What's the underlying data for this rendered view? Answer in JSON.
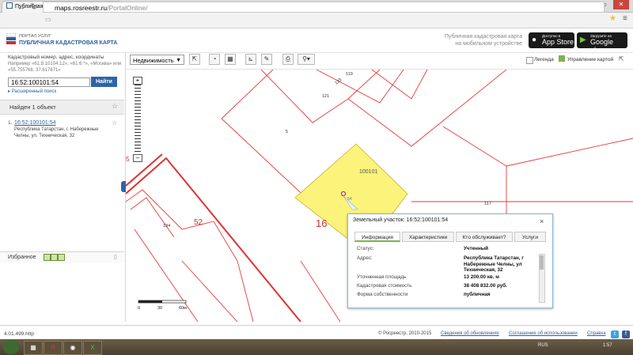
{
  "browser": {
    "tab_title": "Публичная кадастрова",
    "url_host": "maps.rosreestr.ru",
    "url_path": "/PortalOnline/"
  },
  "header": {
    "portal": "ПОРТАЛ УСЛУГ",
    "title": "ПУБЛИЧНАЯ КАДАСТРОВАЯ КАРТА",
    "mobile_line1": "Публичная кадастровая карта",
    "mobile_line2": "на мобильном устройстве",
    "appstore_small": "Доступно в",
    "appstore_big": "App Store",
    "googleplay_small": "Загрузите на",
    "googleplay_big": "Google play"
  },
  "search": {
    "hint": "Кадастровый номер, адрес, координаты",
    "example": "Например «61:8:10104:12», «61:6:*», «Москва» или «55.755768, 37.617671»",
    "value": "16:52:100101:54",
    "button": "Найти",
    "extended": "Расширенный поиск"
  },
  "results": {
    "found": "Найден 1 объект",
    "items": [
      {
        "num": "1.",
        "cadastral": "16:52:100101:54",
        "address": "Республика Татарстан, г. Набережные Челны, ул. Техническая, 32"
      }
    ]
  },
  "favorites": {
    "label": "Избранное"
  },
  "version": "4.01.499.http",
  "toolbar": {
    "layer_select": "Недвижимость",
    "legend": "Легенда",
    "management": "Управление картой"
  },
  "map": {
    "labels": [
      "119",
      "123",
      "121",
      "5",
      "100101",
      "117",
      "16",
      "134",
      "52",
      "5"
    ],
    "parcel_label": "54",
    "scale": [
      "0",
      "30",
      "60м"
    ]
  },
  "popup": {
    "title": "Земельный участок: 16:52:100101:54",
    "tabs": [
      "Информация",
      "Характеристики",
      "Кто обслуживает?",
      "Услуги"
    ],
    "rows": [
      {
        "label": "Статус:",
        "value": "Учтенный"
      },
      {
        "label": "Адрес:",
        "value": "Республика Татарстан, г Набережные Челны, ул Техническая, 32"
      },
      {
        "label": "Уточненная площадь",
        "value": "13 200.00 кв. м"
      },
      {
        "label": "Кадастровая стоимость",
        "value": "38 408 832.00 руб."
      },
      {
        "label": "Форма собственности",
        "value": "публичная"
      }
    ]
  },
  "footer": {
    "copyright": "© Росреестр, 2010-2015",
    "links": [
      "Сведения об обновлениях",
      "Соглашение об использовании",
      "Справка"
    ]
  },
  "taskbar": {
    "lang": "RUS",
    "time": "1:57"
  }
}
